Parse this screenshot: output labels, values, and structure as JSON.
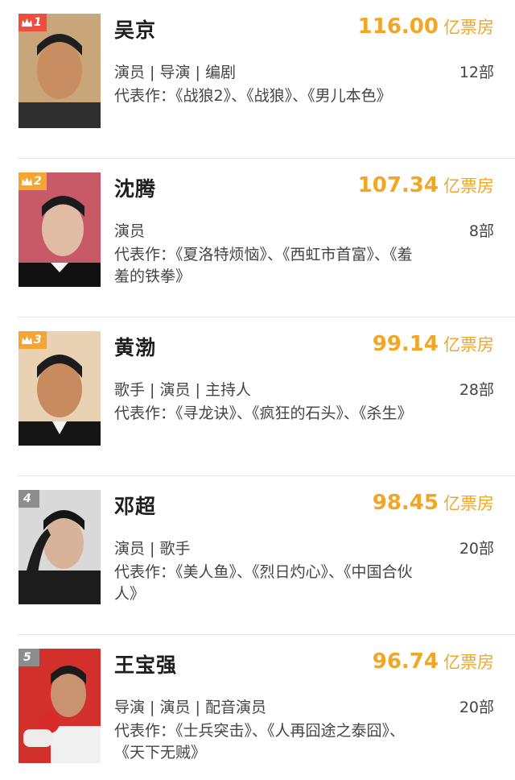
{
  "list": {
    "box_unit": "亿票房",
    "items": [
      {
        "rank": "1",
        "name": "吴京",
        "box": "116.00",
        "roles": "演员 | 导演 | 编剧",
        "count": "12部",
        "works": "代表作：《战狼2》、《战狼》、《男儿本色》",
        "badge_color": "#ef4d3d"
      },
      {
        "rank": "2",
        "name": "沈腾",
        "box": "107.34",
        "roles": "演员",
        "count": "8部",
        "works": "代表作：《夏洛特烦恼》、《西虹市首富》、《羞羞的铁拳》",
        "badge_color": "#f4a534"
      },
      {
        "rank": "3",
        "name": "黄渤",
        "box": "99.14",
        "roles": "歌手 | 演员 | 主持人",
        "count": "28部",
        "works": "代表作：《寻龙诀》、《疯狂的石头》、《杀生》",
        "badge_color": "#f4a534"
      },
      {
        "rank": "4",
        "name": "邓超",
        "box": "98.45",
        "roles": "演员 | 歌手",
        "count": "20部",
        "works": "代表作：《美人鱼》、《烈日灼心》、《中国合伙人》",
        "badge_color": "#8d8d8d"
      },
      {
        "rank": "5",
        "name": "王宝强",
        "box": "96.74",
        "roles": "导演 | 演员 | 配音演员",
        "count": "20部",
        "works": "代表作：《士兵突击》、《人再囧途之泰囧》、《天下无贼》",
        "badge_color": "#8d8d8d"
      }
    ]
  },
  "colors": {
    "accent": "#f1a627",
    "divider": "#e6e6e6"
  }
}
